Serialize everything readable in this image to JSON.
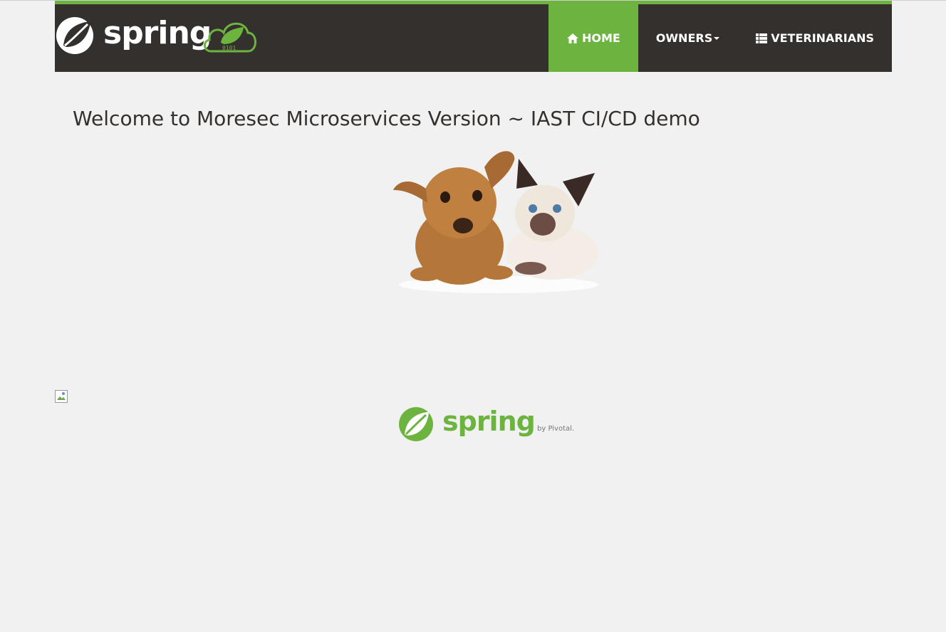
{
  "brand": {
    "name": "spring",
    "cloud_digits": "0101"
  },
  "nav": {
    "items": [
      {
        "label": "HOME",
        "icon": "home-icon",
        "active": true
      },
      {
        "label": "OWNERS",
        "icon": "chevron-down-icon",
        "active": false
      },
      {
        "label": "VETERINARIANS",
        "icon": "list-icon",
        "active": false
      }
    ]
  },
  "main": {
    "heading": "Welcome to Moresec Microservices Version ~ IAST CI/CD demo"
  },
  "footer": {
    "logo_text": "spring",
    "by_text": "by Pivotal."
  },
  "colors": {
    "accent": "#6db33f",
    "navbar": "#34302d",
    "background": "#f1f1f1"
  }
}
